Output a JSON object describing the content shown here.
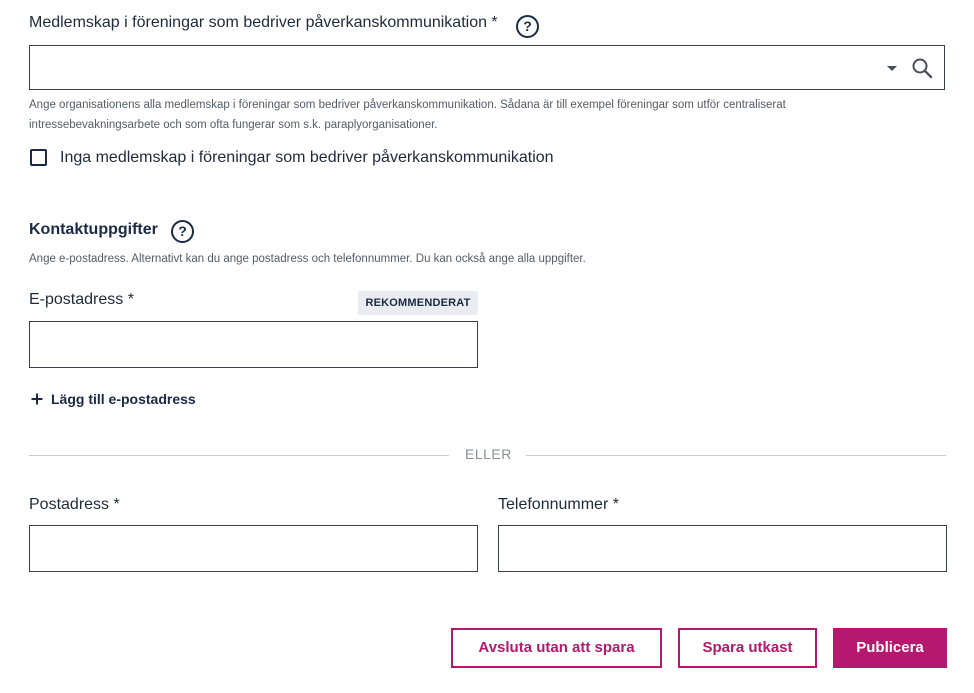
{
  "memberships": {
    "label": "Medlemskap i föreningar som bedriver påverkanskommunikation *",
    "help_glyph": "?",
    "value": "",
    "hint_line1": "Ange organisationens alla medlemskap i föreningar som bedriver påverkanskommunikation. Sådana är till exempel föreningar som utför centraliserat",
    "hint_line2": "intressebevakningsarbete och som ofta fungerar som s.k. paraplyorganisationer.",
    "none_checkbox_label": "Inga medlemskap i föreningar som bedriver påverkanskommunikation",
    "none_checked": false
  },
  "contact": {
    "title": "Kontaktuppgifter",
    "help_glyph": "?",
    "hint": "Ange e-postadress. Alternativt kan du ange postadress och telefonnummer. Du kan också ange alla uppgifter.",
    "email_label": "E-postadress *",
    "recommended_badge": "REKOMMENDERAT",
    "email_value": "",
    "add_email_label": "Lägg till e-postadress",
    "add_icon": "plus-icon",
    "or_text": "ELLER",
    "postal_label": "Postadress *",
    "postal_value": "",
    "phone_label": "Telefonnummer *",
    "phone_value": ""
  },
  "actions": {
    "exit_label": "Avsluta utan att spara",
    "draft_label": "Spara utkast",
    "publish_label": "Publicera"
  },
  "colors": {
    "accent": "#b5186e",
    "heading": "#1b2a44",
    "border": "#3a3f4a",
    "badge_bg": "#e9edf2"
  }
}
